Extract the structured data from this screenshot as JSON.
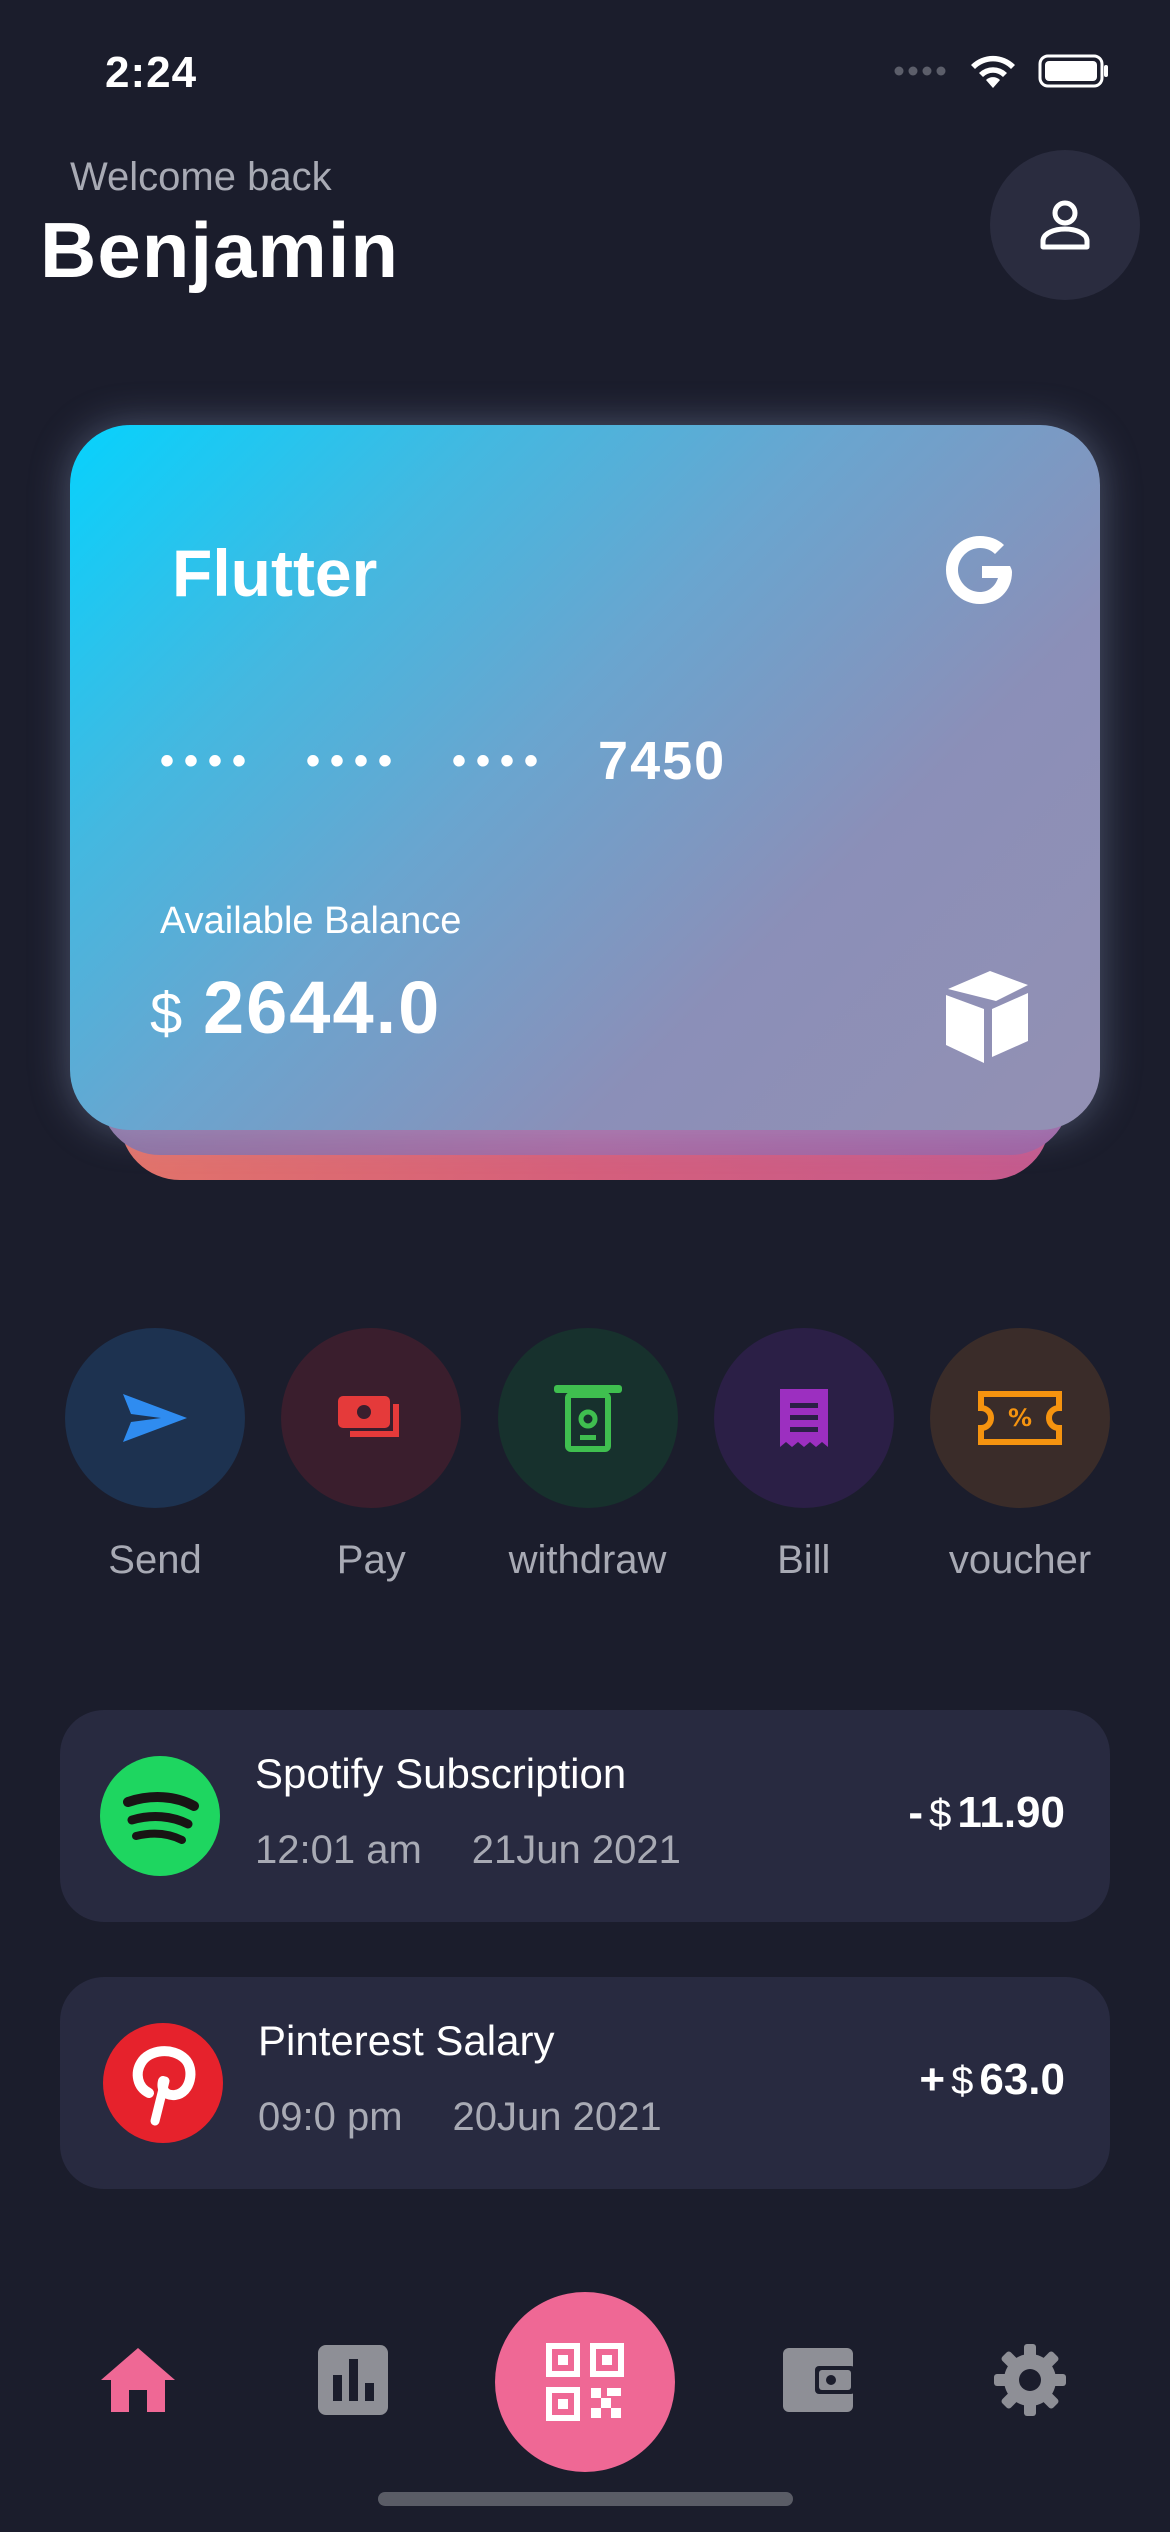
{
  "status_bar": {
    "time": "2:24"
  },
  "header": {
    "welcome": "Welcome back",
    "username": "Benjamin"
  },
  "card": {
    "brand": "Flutter",
    "masked_groups": [
      "••••",
      "••••",
      "••••"
    ],
    "last4": "7450",
    "balance_label": "Available Balance",
    "currency": "$",
    "balance": "2644.0"
  },
  "actions": [
    {
      "label": "Send",
      "icon": "send-icon",
      "color": "#2f8cf0",
      "bg": "#1d3250"
    },
    {
      "label": "Pay",
      "icon": "payment-icon",
      "color": "#e53a3a",
      "bg": "#3a1e2d"
    },
    {
      "label": "withdraw",
      "icon": "atm-icon",
      "color": "#3fbf4f",
      "bg": "#17312d"
    },
    {
      "label": "Bill",
      "icon": "receipt-icon",
      "color": "#9c2fc0",
      "bg": "#2b1f46"
    },
    {
      "label": "voucher",
      "icon": "ticket-icon",
      "color": "#f5930f",
      "bg": "#3a2c29"
    }
  ],
  "transactions": [
    {
      "title": "Spotify Subscription",
      "time": "12:01 am",
      "date": "21Jun 2021",
      "sign": "-",
      "currency": "$",
      "amount": "11.90",
      "icon": "spotify-icon",
      "icon_bg": "#1ed660"
    },
    {
      "title": "Pinterest Salary",
      "time": "09:0 pm",
      "date": "20Jun 2021",
      "sign": "+",
      "currency": "$",
      "amount": "63.0",
      "icon": "pinterest-icon",
      "icon_bg": "#e6222c"
    }
  ],
  "nav": {
    "accent": "#ef6895",
    "items": [
      "home-icon",
      "chart-icon",
      "qr-scan-icon",
      "wallet-icon",
      "settings-icon"
    ]
  }
}
